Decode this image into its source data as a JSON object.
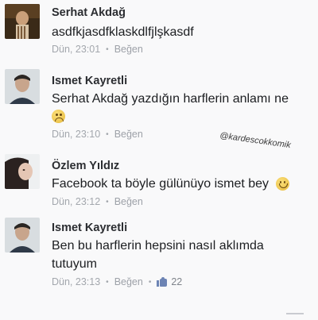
{
  "comments": [
    {
      "name": "Serhat Akdağ",
      "text": "asdfkjasdfklaskdlfjlşkasdf",
      "time": "Dün, 23:01",
      "like_label": "Beğen"
    },
    {
      "name": "Ismet Kayretli",
      "text": "Serhat Akdağ yazdığın harflerin anlamı ne",
      "emoji": "sad-face-icon",
      "time": "Dün, 23:10",
      "like_label": "Beğen"
    },
    {
      "name": "Özlem Yıldız",
      "text": "Facebook ta böyle gülünüyo ismet bey",
      "emoji": "smile-face-icon",
      "time": "Dün, 23:12",
      "like_label": "Beğen"
    },
    {
      "name": "Ismet Kayretli",
      "text_line1": "Ben bu harflerin hepsini nasıl aklımda",
      "text_line2": "tutuyum",
      "time": "Dün, 23:13",
      "like_label": "Beğen",
      "like_count": "22"
    }
  ],
  "watermark": "@kardescokkomik",
  "colors": {
    "name": "#2b2d31",
    "meta": "#a3a7ad",
    "like_icon": "#6d84b4"
  }
}
